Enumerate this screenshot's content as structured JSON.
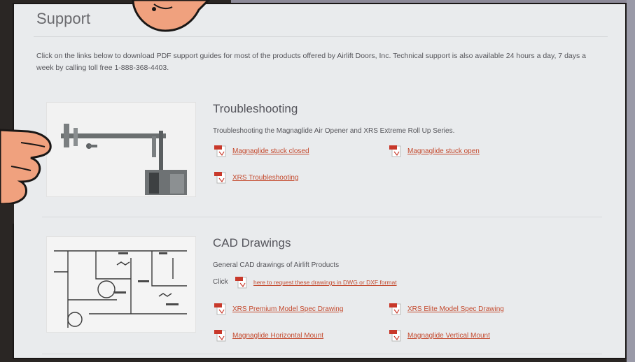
{
  "page": {
    "title": "Support",
    "intro": "Click on the links below to download PDF support guides for most of the products offered by Airlift Doors, Inc. Technical support is also available 24 hours a day, 7 days a week by calling toll free 1-888-368-4403."
  },
  "troubleshooting": {
    "title": "Troubleshooting",
    "description": "Troubleshooting the Magnaglide Air Opener and XRS Extreme Roll Up Series.",
    "links": [
      {
        "label": "Magnaglide stuck closed"
      },
      {
        "label": "Magnaglide stuck open"
      },
      {
        "label": "XRS Troubleshooting"
      }
    ]
  },
  "cad": {
    "title": "CAD Drawings",
    "description": "General CAD drawings of Airlift Products",
    "click_prefix": "Click",
    "request_link": "here to request these drawings in DWG or DXF format",
    "links": [
      {
        "label": "XRS Premium Model Spec Drawing"
      },
      {
        "label": "XRS Elite Model Spec Drawing"
      },
      {
        "label": "Magnaglide Horizontal Mount"
      },
      {
        "label": "Magnaglide Vertical Mount"
      }
    ]
  },
  "icons": {
    "pdf": "pdf-document-icon",
    "pdf_badge_color": "#c8382a",
    "link_color": "#c44a2e"
  }
}
